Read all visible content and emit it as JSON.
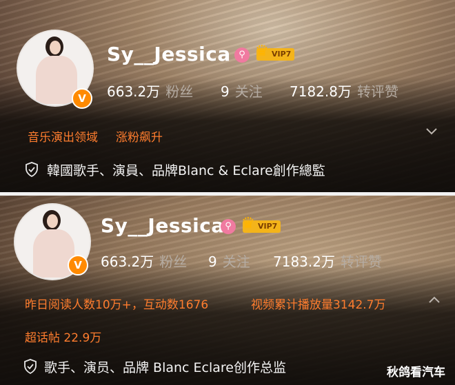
{
  "profiles": [
    {
      "username": "Sy__Jessica",
      "vip_label": "VIP7",
      "verified_badge": "V",
      "stats": [
        {
          "value": "663.2万",
          "label": "粉丝"
        },
        {
          "value": "9",
          "label": "关注"
        },
        {
          "value": "7182.8万",
          "label": "转评赞"
        }
      ],
      "highlight_tags": [
        "音乐演出领域",
        "涨粉飙升"
      ],
      "description": "韓國歌手、演員、品牌Blanc & Eclare創作總監",
      "icons": {
        "expand": "chevron-down-icon",
        "verify": "shield-check-icon",
        "vip": "crown-icon",
        "special": "pink-magnifier-icon"
      }
    },
    {
      "username": "Sy__Jessica",
      "vip_label": "VIP7",
      "verified_badge": "V",
      "stats": [
        {
          "value": "663.2万",
          "label": "粉丝"
        },
        {
          "value": "9",
          "label": "关注"
        },
        {
          "value": "7183.2万",
          "label": "转评赞"
        }
      ],
      "highlight_tags": [
        "昨日阅读人数10万+，互动数1676",
        "视频累计播放量3142.7万",
        "超话帖 22.9万"
      ],
      "description": "歌手、演员、品牌 Blanc Eclare创作总监",
      "icons": {
        "collapse": "chevron-up-icon",
        "verify": "shield-check-icon",
        "vip": "crown-icon",
        "special": "pink-magnifier-icon"
      }
    }
  ],
  "watermark": "秋鸽看汽车",
  "colors": {
    "accent_orange": "#ff7d2e",
    "vip_gold": "#f4b41a",
    "verified_orange": "#ff8a00",
    "stat_label": "#b5aca3"
  }
}
